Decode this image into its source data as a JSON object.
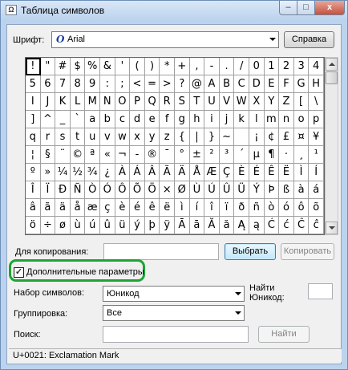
{
  "window": {
    "title": "Таблица символов",
    "minimize": "–",
    "maximize": "□",
    "close": "x"
  },
  "font_row": {
    "label": "Шрифт:",
    "font_icon": "О",
    "value": "Arial",
    "help_button": "Справка"
  },
  "grid": {
    "rows": [
      [
        "!",
        "\"",
        "#",
        "$",
        "%",
        "&",
        "'",
        "(",
        ")",
        "*",
        "+",
        ",",
        "-",
        ".",
        "/",
        "0",
        "1",
        "2",
        "3",
        "4"
      ],
      [
        "5",
        "6",
        "7",
        "8",
        "9",
        ":",
        ";",
        "<",
        "=",
        ">",
        "?",
        "@",
        "A",
        "B",
        "C",
        "D",
        "E",
        "F",
        "G",
        "H"
      ],
      [
        "I",
        "J",
        "K",
        "L",
        "M",
        "N",
        "O",
        "P",
        "Q",
        "R",
        "S",
        "T",
        "U",
        "V",
        "W",
        "X",
        "Y",
        "Z",
        "[",
        "\\"
      ],
      [
        "]",
        "^",
        "_",
        "`",
        "a",
        "b",
        "c",
        "d",
        "e",
        "f",
        "g",
        "h",
        "i",
        "j",
        "k",
        "l",
        "m",
        "n",
        "o",
        "p"
      ],
      [
        "q",
        "r",
        "s",
        "t",
        "u",
        "v",
        "w",
        "x",
        "y",
        "z",
        "{",
        "|",
        "}",
        "~",
        " ",
        "¡",
        "¢",
        "£",
        "¤",
        "¥"
      ],
      [
        "¦",
        "§",
        "¨",
        "©",
        "ª",
        "«",
        "¬",
        "-",
        "®",
        "¯",
        "°",
        "±",
        "²",
        "³",
        "´",
        "µ",
        "¶",
        "·",
        "¸",
        "¹"
      ],
      [
        "º",
        "»",
        "¼",
        "½",
        "¾",
        "¿",
        "À",
        "Á",
        "Â",
        "Ã",
        "Ä",
        "Å",
        "Æ",
        "Ç",
        "È",
        "É",
        "Ê",
        "Ë",
        "Ì",
        "Í"
      ],
      [
        "Î",
        "Ï",
        "Ð",
        "Ñ",
        "Ò",
        "Ó",
        "Ô",
        "Õ",
        "Ö",
        "×",
        "Ø",
        "Ù",
        "Ú",
        "Û",
        "Ü",
        "Ý",
        "Þ",
        "ß",
        "à",
        "á"
      ],
      [
        "â",
        "ã",
        "ä",
        "å",
        "æ",
        "ç",
        "è",
        "é",
        "ê",
        "ë",
        "ì",
        "í",
        "î",
        "ï",
        "ð",
        "ñ",
        "ò",
        "ó",
        "ô",
        "õ"
      ],
      [
        "ö",
        "÷",
        "ø",
        "ù",
        "ú",
        "û",
        "ü",
        "ý",
        "þ",
        "ÿ",
        "Ā",
        "ā",
        "Ă",
        "ă",
        "Ą",
        "ą",
        "Ć",
        "ć",
        "Ĉ",
        "ĉ"
      ]
    ],
    "selected_index": 0
  },
  "copy_row": {
    "label": "Для копирования:",
    "value": "",
    "select_button": "Выбрать",
    "copy_button": "Копировать"
  },
  "advanced": {
    "label": "Дополнительные параметры",
    "checked": true,
    "checkmark": "✓"
  },
  "charset": {
    "label": "Набор символов:",
    "value": "Юникод",
    "goto_label": "Найти Юникод:"
  },
  "grouping": {
    "label": "Группировка:",
    "value": "Все"
  },
  "search": {
    "label": "Поиск:",
    "placeholder": "",
    "button": "Найти"
  },
  "status": {
    "text": "U+0021: Exclamation Mark"
  },
  "colors": {
    "highlight": "#1ca532",
    "titlebar": "#bcd3ee"
  }
}
